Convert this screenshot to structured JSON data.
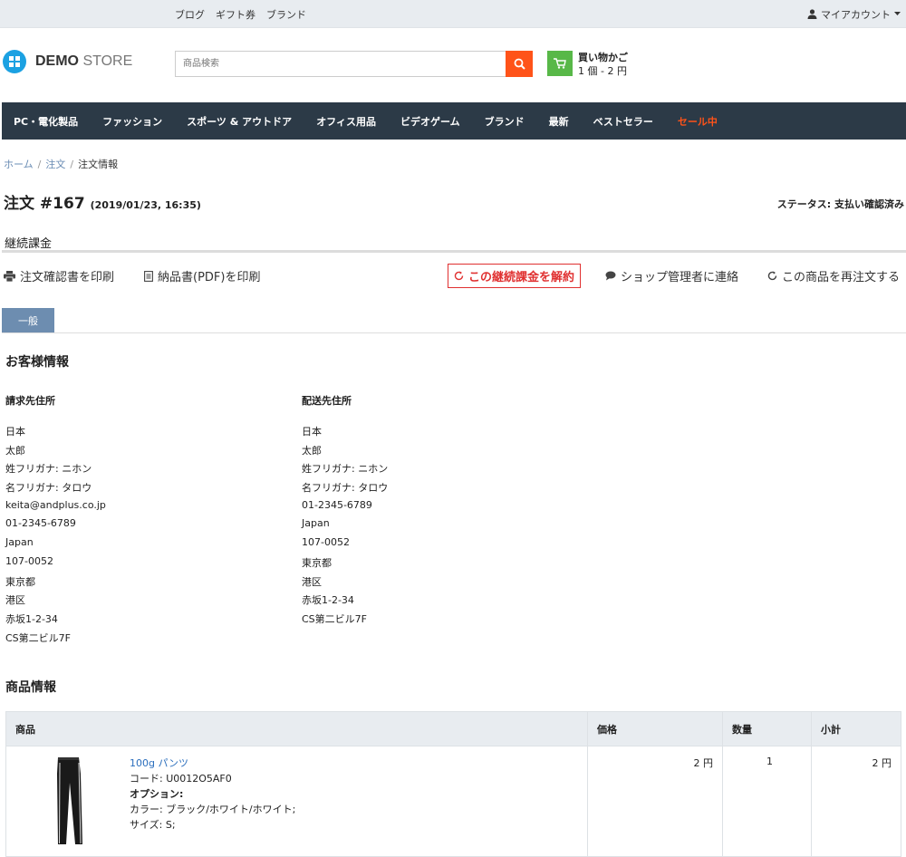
{
  "topbar": {
    "links": [
      "ブログ",
      "ギフト券",
      "ブランド"
    ],
    "account_label": "マイアカウント"
  },
  "header": {
    "logo_bold": "DEMO",
    "logo_light": "STORE",
    "search_placeholder": "商品検索",
    "cart_title": "買い物かご",
    "cart_summary": "1 個 - 2 円"
  },
  "nav": {
    "items": [
      "PC・電化製品",
      "ファッション",
      "スポーツ & アウトドア",
      "オフィス用品",
      "ビデオゲーム",
      "ブランド",
      "最新",
      "ベストセラー"
    ],
    "sale": "セール中"
  },
  "breadcrumb": {
    "home": "ホーム",
    "orders": "注文",
    "current": "注文情報",
    "sep": "/"
  },
  "order": {
    "title": "注文 #167",
    "date": "(2019/01/23, 16:35)",
    "status": "ステータス: 支払い確認済み",
    "subscription_label": "継続課金"
  },
  "actions": {
    "print_confirmation": "注文確認書を印刷",
    "print_invoice": "納品書(PDF)を印刷",
    "cancel_subscription": "この継続課金を解約",
    "contact_admin": "ショップ管理者に連絡",
    "reorder": "この商品を再注文する"
  },
  "tabs": {
    "general": "一般"
  },
  "customer": {
    "section_title": "お客様情報",
    "billing": {
      "heading": "請求先住所",
      "lines": [
        "日本",
        "太郎",
        "姓フリガナ: ニホン",
        "名フリガナ: タロウ",
        "keita@andplus.co.jp",
        "01-2345-6789",
        "Japan",
        "107-0052",
        "東京都",
        "港区",
        "赤坂1-2-34",
        "CS第二ビル7F"
      ]
    },
    "shipping": {
      "heading": "配送先住所",
      "lines": [
        "日本",
        "太郎",
        "姓フリガナ: ニホン",
        "名フリガナ: タロウ",
        "01-2345-6789",
        "Japan",
        "107-0052",
        "東京都",
        "港区",
        "赤坂1-2-34",
        "CS第二ビル7F"
      ]
    }
  },
  "products": {
    "section_title": "商品情報",
    "headers": {
      "product": "商品",
      "price": "価格",
      "qty": "数量",
      "subtotal": "小計"
    },
    "rows": [
      {
        "name": "100g パンツ",
        "code": "コード: U0012O5AF0",
        "options_label": "オプション:",
        "color": "カラー: ブラック/ホワイト/ホワイト;",
        "size": "サイズ: S;",
        "price": "2 円",
        "qty": "1",
        "subtotal": "2 円"
      }
    ]
  },
  "colors": {
    "accent_orange": "#ff5319",
    "cart_green": "#58b848",
    "nav_bg": "#2c3a47",
    "cancel_red": "#e03030",
    "tab_blue": "#6d8db0",
    "link_blue": "#2a6ebd"
  }
}
